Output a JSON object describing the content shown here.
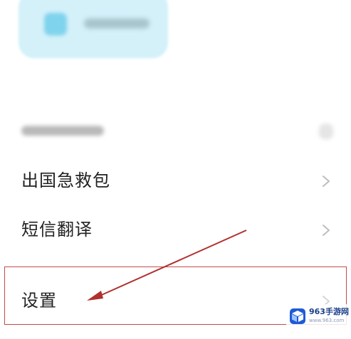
{
  "menu": {
    "items": [
      {
        "label": "出国急救包",
        "icon": "chevron-right-icon"
      },
      {
        "label": "短信翻译",
        "icon": "chevron-right-icon"
      },
      {
        "label": "设置",
        "icon": "chevron-right-icon"
      }
    ]
  },
  "annotation": {
    "highlight_color": "#c44a4a",
    "arrow_color": "#b0302e",
    "target": "设置"
  },
  "watermark": {
    "name": "963手游网",
    "url": "www.963.com"
  },
  "colors": {
    "background": "#ffffff",
    "card": "#d4f1fa",
    "text": "#222222",
    "chevron": "#bdbdbd"
  }
}
